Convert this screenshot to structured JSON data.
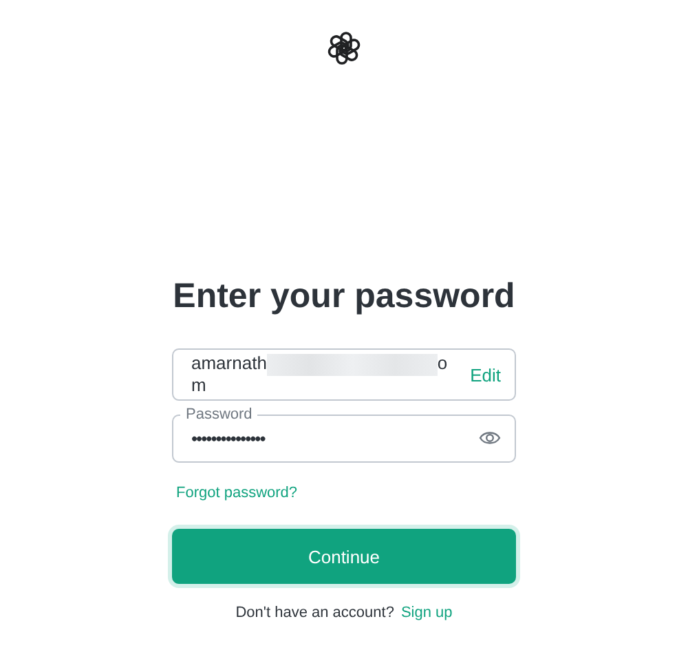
{
  "title": "Enter your password",
  "email_field": {
    "value_start": "amarnath",
    "value_end": "o",
    "value_wrap": "m",
    "redacted": true,
    "action": "Edit"
  },
  "password_field": {
    "label": "Password",
    "value": "•••••••••••••••"
  },
  "forgot_link": "Forgot password?",
  "continue_button": "Continue",
  "signup": {
    "prompt": "Don't have an account?",
    "link": "Sign up"
  }
}
